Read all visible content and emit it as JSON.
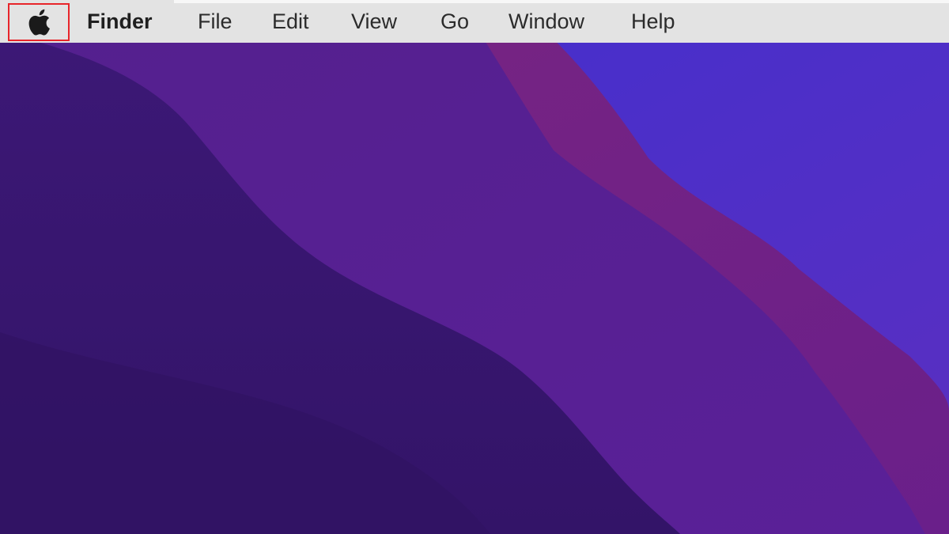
{
  "menubar": {
    "apple_icon": "apple-logo-icon",
    "app_name": "Finder",
    "items": [
      "File",
      "Edit",
      "View",
      "Go",
      "Window",
      "Help"
    ]
  },
  "highlight": {
    "target": "apple-menu",
    "color": "#e8252a"
  },
  "colors": {
    "menubar_bg": "#e3e3e3",
    "wallpaper_dark": "#3a176f",
    "wallpaper_mid": "#5a1f8f",
    "wallpaper_magenta": "#7a2488",
    "wallpaper_blue": "#4a2cc8"
  }
}
